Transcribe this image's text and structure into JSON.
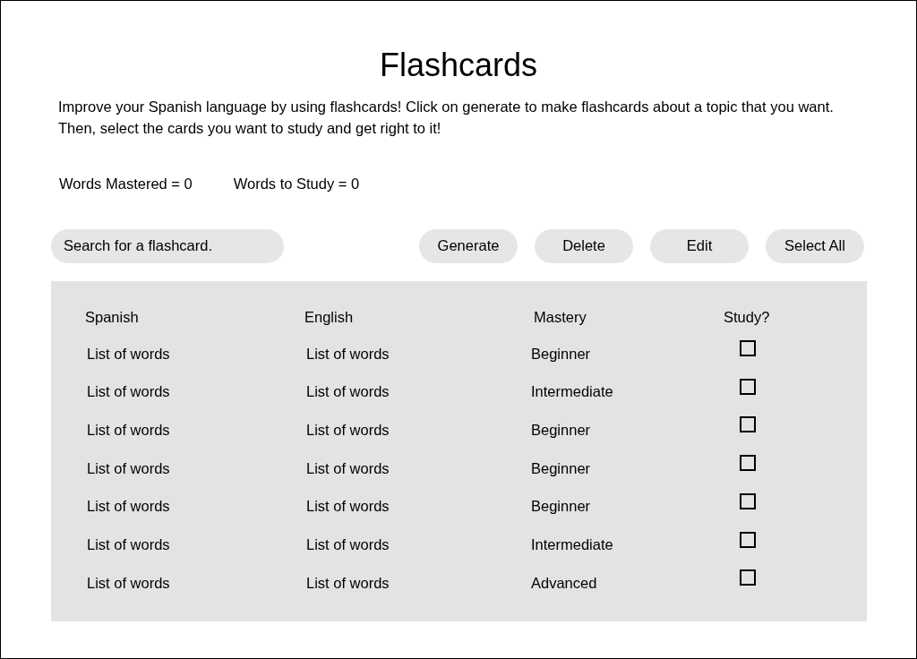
{
  "title": "Flashcards",
  "intro": "Improve your Spanish language by using flashcards! Click on generate to make flashcards about a topic that you want. Then, select the cards you want to study and get right to it!",
  "stats": [
    "Words Mastered = 0",
    "Words to Study = 0"
  ],
  "search": {
    "placeholder": "Search for a flashcard."
  },
  "buttons": [
    "Generate",
    "Delete",
    "Edit",
    "Select All"
  ],
  "table": {
    "columns": [
      "Spanish",
      "English",
      "Mastery",
      "Study?"
    ],
    "rows": [
      {
        "spanish": "List of words",
        "english": "List of words",
        "mastery": "Beginner",
        "checked": false
      },
      {
        "spanish": "List of words",
        "english": "List of words",
        "mastery": "Intermediate",
        "checked": false
      },
      {
        "spanish": "List of words",
        "english": "List of words",
        "mastery": "Beginner",
        "checked": false
      },
      {
        "spanish": "List of words",
        "english": "List of words",
        "mastery": "Beginner",
        "checked": false
      },
      {
        "spanish": "List of words",
        "english": "List of words",
        "mastery": "Beginner",
        "checked": false
      },
      {
        "spanish": "List of words",
        "english": "List of words",
        "mastery": "Intermediate",
        "checked": false
      },
      {
        "spanish": "List of words",
        "english": "List of words",
        "mastery": "Advanced",
        "checked": false
      }
    ]
  }
}
